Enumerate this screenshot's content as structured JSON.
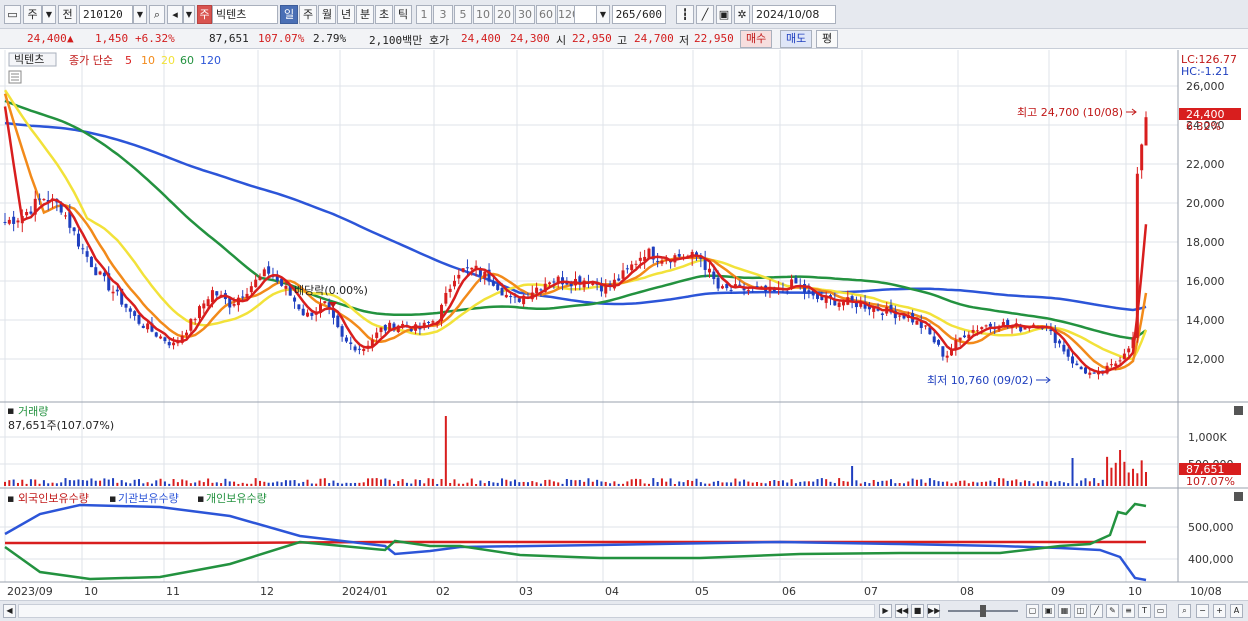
{
  "toolbar": {
    "period_toggle": "주",
    "prev_label": "전",
    "stock_code": "210120",
    "stock_badge": "주",
    "stock_name": "빅텐츠",
    "periods": [
      "일",
      "주",
      "월",
      "년",
      "분",
      "초",
      "틱"
    ],
    "active_period": "일",
    "intervals": [
      "1",
      "3",
      "5",
      "10",
      "20",
      "30",
      "60",
      "120"
    ],
    "count_value": "265",
    "count_total": "/600",
    "date_value": "2024/10/08"
  },
  "quote": {
    "price": "24,400",
    "arrow": "▲",
    "change": "1,450",
    "change_pct": "+6.32%",
    "volume": "87,651",
    "volume_ratio": "107.07%",
    "turnover_pct": "2.79%",
    "amount": "2,100백만",
    "bid_ask_label": "호가",
    "ask": "24,400",
    "bid": "24,300",
    "open_label": "시",
    "open": "22,950",
    "high_label": "고",
    "high": "24,700",
    "low_label": "저",
    "low": "22,950",
    "buy_label": "매수",
    "sell_label": "매도",
    "avg_label": "평"
  },
  "price_panel": {
    "stock_tab": "빅텐츠",
    "ma_title": "종가 단순",
    "ma_periods": [
      "5",
      "10",
      "20",
      "60",
      "120"
    ],
    "lc": "LC:126.77",
    "hc": "HC:-1.21",
    "current_price": "24,400",
    "current_pct": "6.32%",
    "high_note": "최고 24,700 (10/08)",
    "low_note": "최저 10,760 (09/02)",
    "dividend_note": "배당락(0.00%)",
    "y_ticks": [
      "26,000",
      "24,000",
      "22,000",
      "20,000",
      "18,000",
      "16,000",
      "14,000",
      "12,000"
    ]
  },
  "volume_panel": {
    "title": "거래량",
    "value_text": "87,651주(107.07%)",
    "y_ticks": [
      "1,000K",
      "500,000"
    ],
    "current_volume": "87,651",
    "current_pct": "107.07%"
  },
  "holdings_panel": {
    "legends": [
      "외국인보유수량",
      "기관보유수량",
      "개인보유수량"
    ],
    "y_ticks": [
      "500,000",
      "400,000"
    ]
  },
  "x_axis": {
    "labels": [
      "2023/09",
      "10",
      "11",
      "12",
      "2024/01",
      "02",
      "03",
      "04",
      "05",
      "06",
      "07",
      "08",
      "09",
      "10",
      "10/08"
    ]
  },
  "colors": {
    "ma5": "#d81e1e",
    "ma10": "#f28a1a",
    "ma20": "#f2e23a",
    "ma60": "#23923f",
    "ma120": "#2c55d8",
    "up": "#d81e1e",
    "down": "#1f3fbf",
    "foreign": "#d81e1e",
    "institution": "#2c55d8",
    "individual": "#23923f"
  },
  "chart_data": {
    "type": "candlestick",
    "period": "daily",
    "y_range": [
      10500,
      27500
    ],
    "series_labels": [
      "종가 단순 5",
      "10",
      "20",
      "60",
      "120"
    ],
    "x_month_labels": [
      "2023/09",
      "10",
      "11",
      "12",
      "2024/01",
      "02",
      "03",
      "04",
      "05",
      "06",
      "07",
      "08",
      "09",
      "10"
    ],
    "close_path": [
      [
        "2023/09",
        19000
      ],
      [
        "2023/09",
        19400
      ],
      [
        "2023/09",
        20300
      ],
      [
        "10",
        19800
      ],
      [
        "10",
        17800
      ],
      [
        "10",
        16300
      ],
      [
        "10",
        15200
      ],
      [
        "10",
        14000
      ],
      [
        "11",
        13300
      ],
      [
        "11",
        12700
      ],
      [
        "11",
        14000
      ],
      [
        "11",
        15500
      ],
      [
        "11",
        14800
      ],
      [
        "11",
        15700
      ],
      [
        "12",
        16500
      ],
      [
        "12",
        15500
      ],
      [
        "12",
        14200
      ],
      [
        "12",
        14800
      ],
      [
        "12",
        12900
      ],
      [
        "12",
        12500
      ],
      [
        "12",
        13500
      ],
      [
        "12",
        13800
      ],
      [
        "2024/01",
        13500
      ],
      [
        "2024/01",
        14100
      ],
      [
        "2024/01",
        16500
      ],
      [
        "2024/01",
        16600
      ],
      [
        "02",
        16000
      ],
      [
        "02",
        14900
      ],
      [
        "02",
        15500
      ],
      [
        "02",
        16100
      ],
      [
        "02",
        16000
      ],
      [
        "03",
        16100
      ],
      [
        "03",
        15600
      ],
      [
        "03",
        16400
      ],
      [
        "03",
        17500
      ],
      [
        "03",
        17200
      ],
      [
        "03",
        17300
      ],
      [
        "04",
        17200
      ],
      [
        "04",
        15500
      ],
      [
        "04",
        15600
      ],
      [
        "04",
        15500
      ],
      [
        "05",
        15400
      ],
      [
        "05",
        15900
      ],
      [
        "05",
        15100
      ],
      [
        "05",
        15000
      ],
      [
        "06",
        14900
      ],
      [
        "06",
        14700
      ],
      [
        "06",
        14400
      ],
      [
        "06",
        14200
      ],
      [
        "07",
        13500
      ],
      [
        "07",
        12100
      ],
      [
        "07",
        13300
      ],
      [
        "07",
        13700
      ],
      [
        "08",
        13800
      ],
      [
        "08",
        13600
      ],
      [
        "08",
        13900
      ],
      [
        "08",
        12900
      ],
      [
        "09",
        11600
      ],
      [
        "09",
        11100
      ],
      [
        "09",
        11700
      ],
      [
        "09",
        13000
      ],
      [
        "10",
        21500
      ],
      [
        "10",
        23000
      ],
      [
        "10",
        24400
      ]
    ],
    "ohlc_last": {
      "open": 22950,
      "high": 24700,
      "low": 22950,
      "close": 24400
    },
    "high_marker": {
      "date": "10/08",
      "value": 24700
    },
    "low_marker": {
      "date": "09/02",
      "value": 10760
    },
    "current_price": 24400,
    "volume": {
      "last": 87651,
      "last_pct": 107.07,
      "y_ticks": [
        1000000,
        500000
      ]
    },
    "holdings": {
      "y_ticks": [
        500000,
        400000
      ]
    }
  }
}
